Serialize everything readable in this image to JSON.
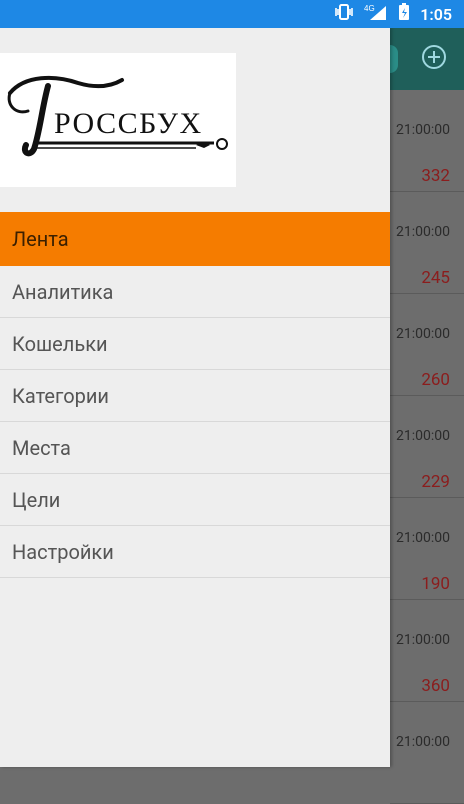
{
  "status_bar": {
    "network": "4G",
    "time": "1:05"
  },
  "logo_text": "ГРОССБУХ",
  "menu": {
    "items": [
      {
        "label": "Лента",
        "active": true
      },
      {
        "label": "Аналитика",
        "active": false
      },
      {
        "label": "Кошельки",
        "active": false
      },
      {
        "label": "Категории",
        "active": false
      },
      {
        "label": "Места",
        "active": false
      },
      {
        "label": "Цели",
        "active": false
      },
      {
        "label": "Настройки",
        "active": false
      }
    ]
  },
  "feed": {
    "items": [
      {
        "time": "21:00:00",
        "amount": "332"
      },
      {
        "time": "21:00:00",
        "amount": "245"
      },
      {
        "time": "21:00:00",
        "amount": "260"
      },
      {
        "time": "21:00:00",
        "amount": "229"
      },
      {
        "time": "21:00:00",
        "amount": "190"
      },
      {
        "time": "21:00:00",
        "amount": "360"
      },
      {
        "time": "21:00:00",
        "amount": ""
      }
    ]
  },
  "colors": {
    "status_bar": "#1e88e5",
    "active_item": "#f57c00",
    "amount": "#8b1d1d"
  }
}
